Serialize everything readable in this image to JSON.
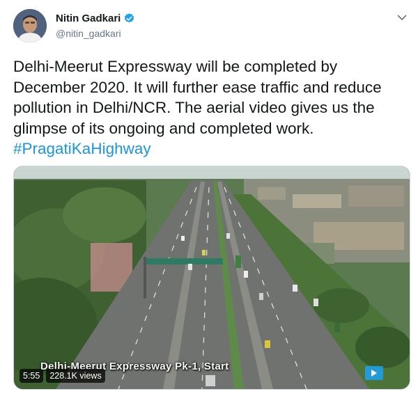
{
  "tweet": {
    "author": {
      "display_name": "Nitin Gadkari",
      "handle": "@nitin_gadkari",
      "verified_icon": "verified-badge-icon",
      "verified_color": "#1da1f2"
    },
    "menu_icon": "chevron-down-icon",
    "text_lines": [
      "Delhi-Meerut Expressway will be completed by",
      "December 2020. It will further ease traffic and reduce",
      "pollution in Delhi/NCR. The aerial video gives us the",
      "glimpse of its ongoing and completed work."
    ],
    "hashtag": "#PragatiKaHighway",
    "hashtag_color": "#1b95e0"
  },
  "video": {
    "caption": "Delhi-Meerut Expressway Pk-1, Start",
    "duration": "5:55",
    "views": "228.1K views",
    "play_icon": "play-icon"
  }
}
